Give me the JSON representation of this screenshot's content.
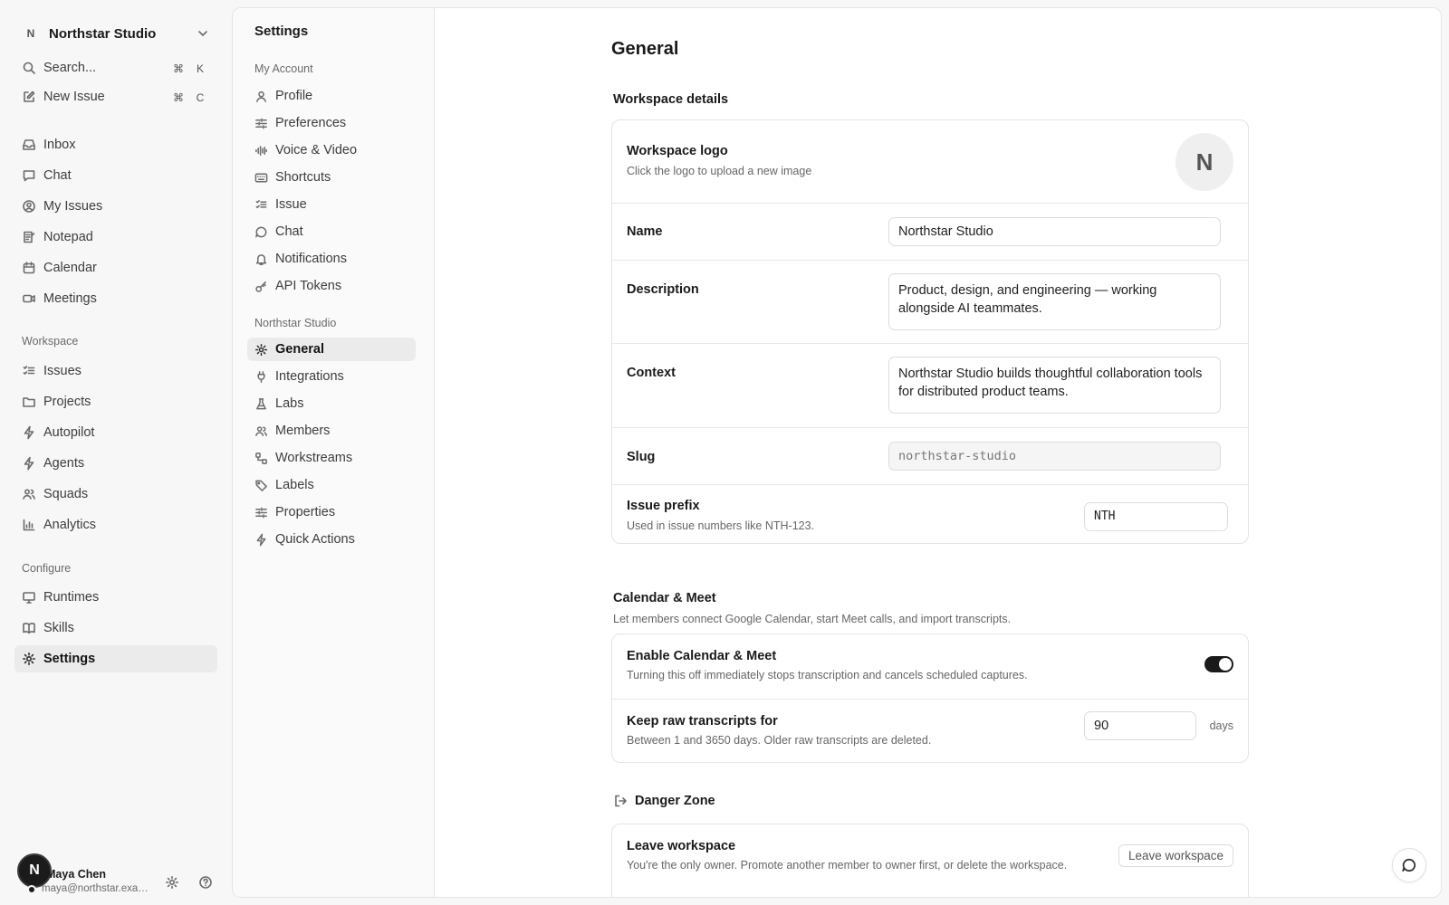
{
  "workspace": {
    "initial": "N",
    "name": "Northstar Studio"
  },
  "sidebar": {
    "search_label": "Search...",
    "search_keys": [
      "⌘",
      "K"
    ],
    "new_issue_label": "New Issue",
    "new_issue_keys": [
      "⌘",
      "C"
    ],
    "primary": [
      {
        "label": "Inbox",
        "icon": "inbox-icon"
      },
      {
        "label": "Chat",
        "icon": "chat-icon"
      },
      {
        "label": "My Issues",
        "icon": "user-circle-icon"
      },
      {
        "label": "Notepad",
        "icon": "notepad-icon"
      },
      {
        "label": "Calendar",
        "icon": "calendar-icon"
      },
      {
        "label": "Meetings",
        "icon": "video-icon"
      }
    ],
    "workspace_section": "Workspace",
    "workspace_items": [
      {
        "label": "Issues",
        "icon": "list-checks-icon"
      },
      {
        "label": "Projects",
        "icon": "folder-icon"
      },
      {
        "label": "Autopilot",
        "icon": "bolt-icon"
      },
      {
        "label": "Agents",
        "icon": "bot-icon"
      },
      {
        "label": "Squads",
        "icon": "users-icon"
      },
      {
        "label": "Analytics",
        "icon": "bar-chart-icon"
      }
    ],
    "configure_section": "Configure",
    "configure_items": [
      {
        "label": "Runtimes",
        "icon": "monitor-icon"
      },
      {
        "label": "Skills",
        "icon": "book-icon"
      },
      {
        "label": "Settings",
        "icon": "gear-icon",
        "active": true
      }
    ],
    "user": {
      "avatar_initial": "N",
      "name": "Maya Chen",
      "email": "maya@northstar.example"
    }
  },
  "settings_nav": {
    "title": "Settings",
    "account_section": "My Account",
    "account_items": [
      {
        "label": "Profile",
        "icon": "user-icon"
      },
      {
        "label": "Preferences",
        "icon": "sliders-icon"
      },
      {
        "label": "Voice & Video",
        "icon": "audio-wave-icon"
      },
      {
        "label": "Shortcuts",
        "icon": "keyboard-icon"
      },
      {
        "label": "Issue",
        "icon": "list-checks-icon"
      },
      {
        "label": "Chat",
        "icon": "chat-icon"
      },
      {
        "label": "Notifications",
        "icon": "bell-icon"
      },
      {
        "label": "API Tokens",
        "icon": "key-icon"
      }
    ],
    "workspace_section": "Northstar Studio",
    "workspace_items": [
      {
        "label": "General",
        "icon": "gear-icon",
        "active": true
      },
      {
        "label": "Integrations",
        "icon": "plug-icon"
      },
      {
        "label": "Labs",
        "icon": "flask-icon"
      },
      {
        "label": "Members",
        "icon": "users-icon"
      },
      {
        "label": "Workstreams",
        "icon": "workflow-icon"
      },
      {
        "label": "Labels",
        "icon": "tag-icon"
      },
      {
        "label": "Properties",
        "icon": "sliders-icon"
      },
      {
        "label": "Quick Actions",
        "icon": "bolt-icon"
      }
    ]
  },
  "general": {
    "title": "General",
    "workspace_details": {
      "heading": "Workspace details",
      "logo_label": "Workspace logo",
      "logo_hint": "Click the logo to upload a new image",
      "logo_initial": "N",
      "name_label": "Name",
      "name_value": "Northstar Studio",
      "description_label": "Description",
      "description_value": "Product, design, and engineering — working alongside AI teammates.",
      "context_label": "Context",
      "context_value": "Northstar Studio builds thoughtful collaboration tools for distributed product teams.",
      "slug_label": "Slug",
      "slug_value": "northstar-studio",
      "prefix_label": "Issue prefix",
      "prefix_hint": "Used in issue numbers like NTH-123.",
      "prefix_value": "NTH"
    },
    "calendar": {
      "heading": "Calendar & Meet",
      "description": "Let members connect Google Calendar, start Meet calls, and import transcripts.",
      "enable_label": "Enable Calendar & Meet",
      "enable_hint": "Turning this off immediately stops transcription and cancels scheduled captures.",
      "enabled": true,
      "keep_label": "Keep raw transcripts for",
      "keep_hint": "Between 1 and 3650 days. Older raw transcripts are deleted.",
      "keep_value": "90",
      "keep_unit": "days"
    },
    "danger": {
      "heading": "Danger Zone",
      "leave_label": "Leave workspace",
      "leave_hint": "You're the only owner. Promote another member to owner first, or delete the workspace.",
      "leave_button": "Leave workspace"
    }
  },
  "colors": {
    "accent": "#1a1a1a",
    "sidebar_bg": "#f7f7f7",
    "active_bg": "#ebebeb",
    "border": "#e4e4e4"
  }
}
